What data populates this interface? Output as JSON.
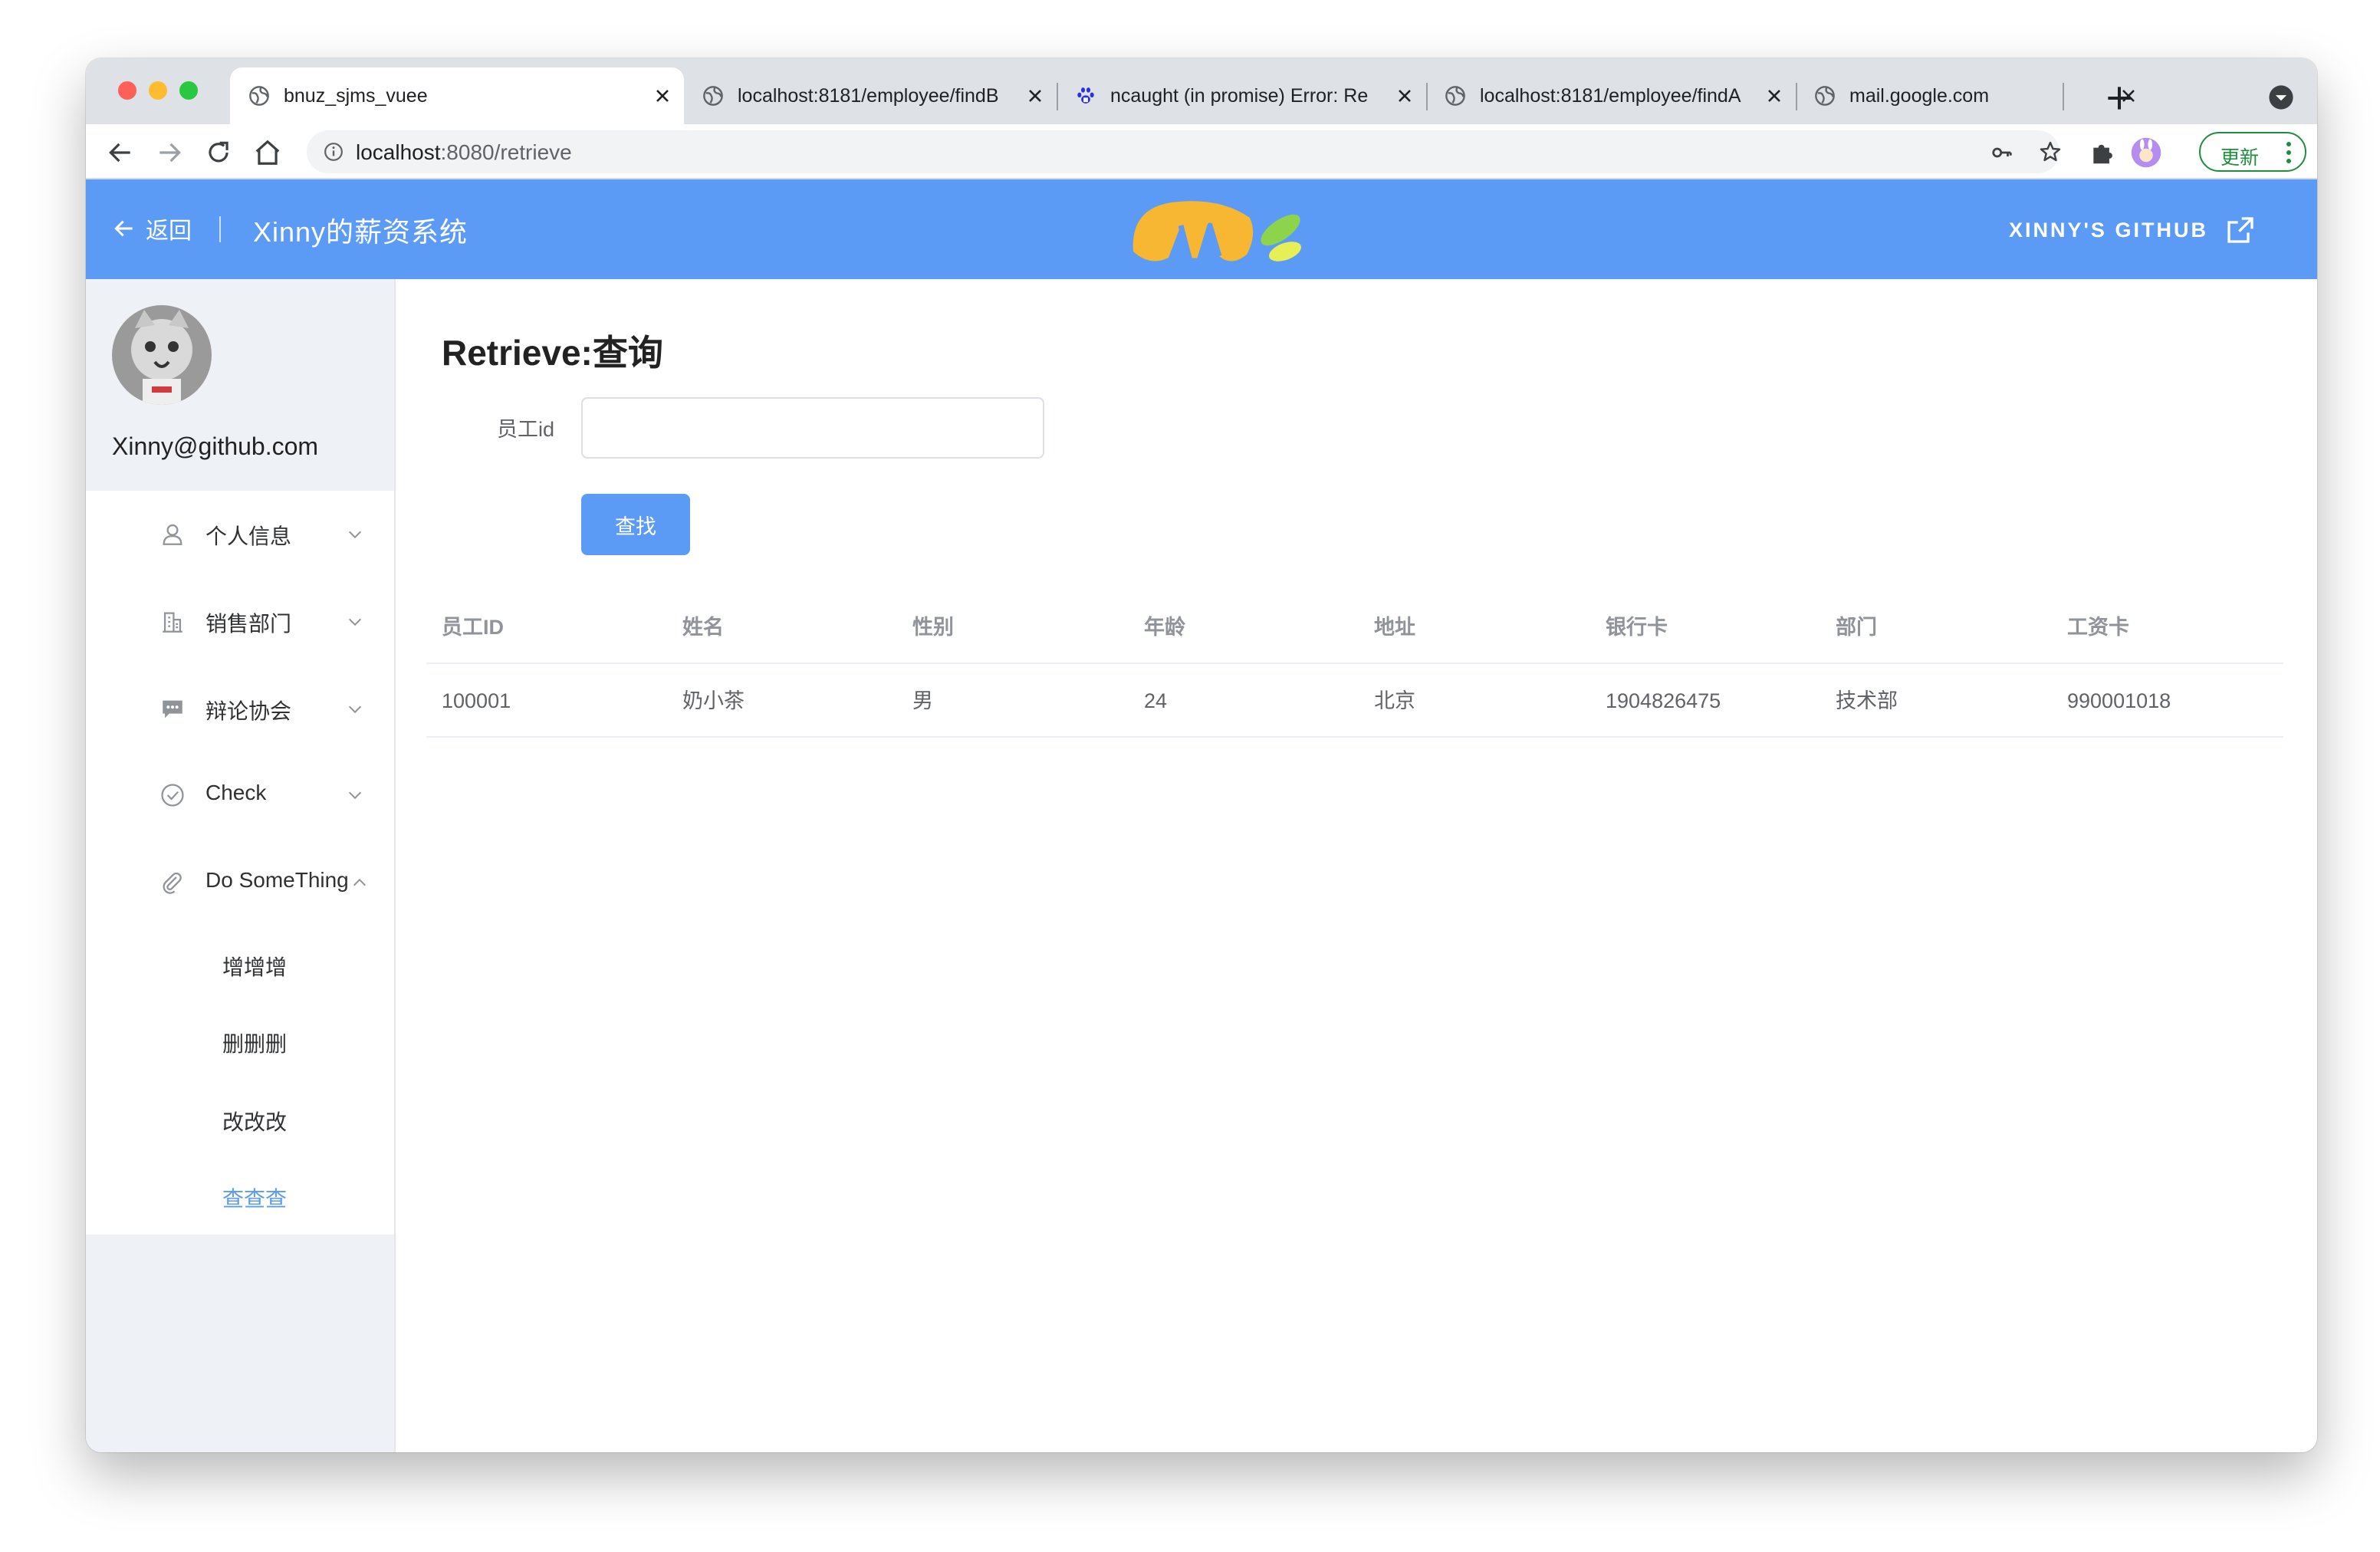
{
  "browser": {
    "tabs": [
      {
        "title": "bnuz_sjms_vuee",
        "icon": "globe-icon",
        "active": true
      },
      {
        "title": "localhost:8181/employee/findB",
        "icon": "globe-icon",
        "active": false
      },
      {
        "title": "ncaught (in promise) Error: Re",
        "icon": "baidu-paw-icon",
        "active": false
      },
      {
        "title": "localhost:8181/employee/findA",
        "icon": "globe-icon",
        "active": false
      },
      {
        "title": "mail.google.com",
        "icon": "globe-icon",
        "active": false
      }
    ],
    "url_host": "localhost",
    "url_rest": ":8080/retrieve",
    "update_label": "更新"
  },
  "header": {
    "back_label": "返回",
    "app_title": "Xinny的薪资系统",
    "github_label": "XINNY'S GITHUB",
    "colors": {
      "header_bg": "#5b9bf5",
      "accent": "#5b9bf5",
      "logo_yellow": "#f7b733",
      "logo_green": "#8ed34c"
    }
  },
  "sidebar": {
    "user_email": "Xinny@github.com",
    "menu": [
      {
        "label": "个人信息",
        "icon": "user-icon",
        "expanded": false
      },
      {
        "label": "销售部门",
        "icon": "office-building-icon",
        "expanded": false
      },
      {
        "label": "辩论协会",
        "icon": "chat-bubble-icon",
        "expanded": false
      },
      {
        "label": "Check",
        "icon": "check-circle-icon",
        "expanded": false
      },
      {
        "label": "Do SomeThing",
        "icon": "paperclip-icon",
        "expanded": true
      }
    ],
    "submenu": [
      {
        "label": "增增增",
        "active": false
      },
      {
        "label": "删删删",
        "active": false
      },
      {
        "label": "改改改",
        "active": false
      },
      {
        "label": "查查查",
        "active": true
      }
    ]
  },
  "main": {
    "page_title": "Retrieve:查询",
    "form": {
      "label": "员工id",
      "value": "",
      "placeholder": ""
    },
    "find_button": "查找",
    "table": {
      "columns": [
        "员工ID",
        "姓名",
        "性别",
        "年龄",
        "地址",
        "银行卡",
        "部门",
        "工资卡"
      ],
      "rows": [
        [
          "100001",
          "奶小茶",
          "男",
          "24",
          "北京",
          "1904826475",
          "技术部",
          "990001018"
        ]
      ]
    }
  }
}
